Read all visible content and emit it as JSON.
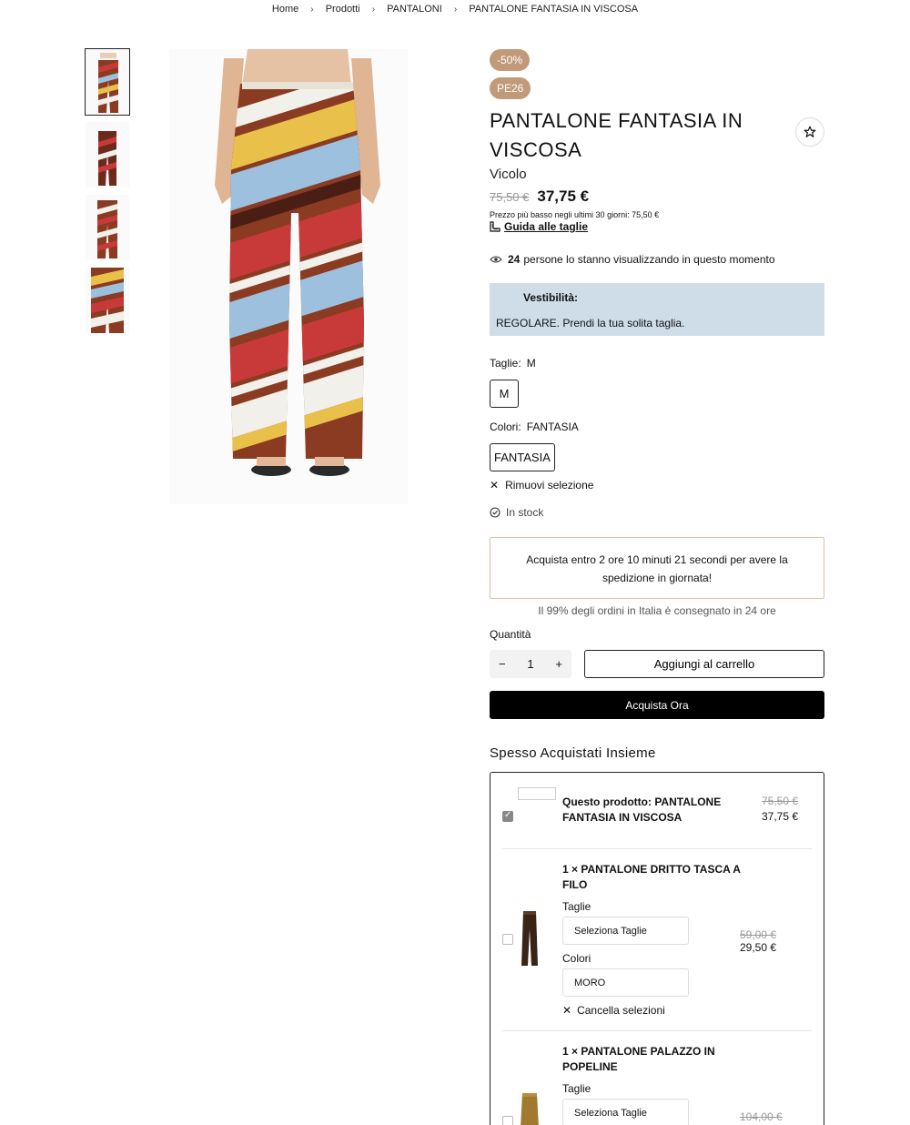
{
  "breadcrumb": [
    "Home",
    "Prodotti",
    "PANTALONI",
    "PANTALONE FANTASIA IN VISCOSA"
  ],
  "product": {
    "discount_badge": "-50%",
    "season_badge": "PE26",
    "title": "PANTALONE FANTASIA IN VISCOSA",
    "brand": "Vicolo",
    "old_price": "75,50 €",
    "new_price": "37,75 €",
    "lowest_price_note": "Prezzo più basso negli ultimi 30 giorni: 75,50 €",
    "size_guide": "Guida alle taglie",
    "viewers_count": "24",
    "viewers_text": "persone lo stanno visualizzando in questo momento"
  },
  "fit": {
    "label": "Vestibilità:",
    "description": "REGOLARE. Prendi la tua solita taglia."
  },
  "options": {
    "size_label": "Taglie:",
    "size_value": "M",
    "size_choice": "M",
    "color_label": "Colori:",
    "color_value": "FANTASIA",
    "color_choice": "FANTASIA",
    "remove_selection": "Rimuovi selezione",
    "stock": "In stock"
  },
  "shipping": {
    "countdown": "Acquista entro 2 ore 10 minuti 21 secondi per avere la spedizione in giornata!",
    "note": "Il 99% degli ordini in Italia è consegnato in 24 ore"
  },
  "purchase": {
    "quantity_label": "Quantità",
    "quantity": "1",
    "add_to_cart": "Aggiungi al carrello",
    "buy_now": "Acquista Ora"
  },
  "fbt": {
    "title": "Spesso Acquistati Insieme",
    "items": [
      {
        "name": "Questo prodotto: PANTALONE FANTASIA IN VISCOSA",
        "old_price": "75,50 €",
        "new_price": "37,75 €",
        "checked": true
      },
      {
        "name": "1 × PANTALONE DRITTO TASCA A FILO",
        "size_label": "Taglie",
        "size_placeholder": "Seleziona Taglie",
        "color_label": "Colori",
        "color_value": "MORO",
        "clear": "Cancella selezioni",
        "old_price": "59,00 €",
        "new_price": "29,50 €",
        "checked": false
      },
      {
        "name": "1 × PANTALONE PALAZZO IN POPELINE",
        "size_label": "Taglie",
        "size_placeholder": "Seleziona Taglie",
        "old_price": "104,00 €",
        "checked": false
      }
    ]
  },
  "colors": {
    "badge": "#c19a7a",
    "fit_bg": "#cfdde9",
    "ship_border": "#d9c2a6"
  }
}
